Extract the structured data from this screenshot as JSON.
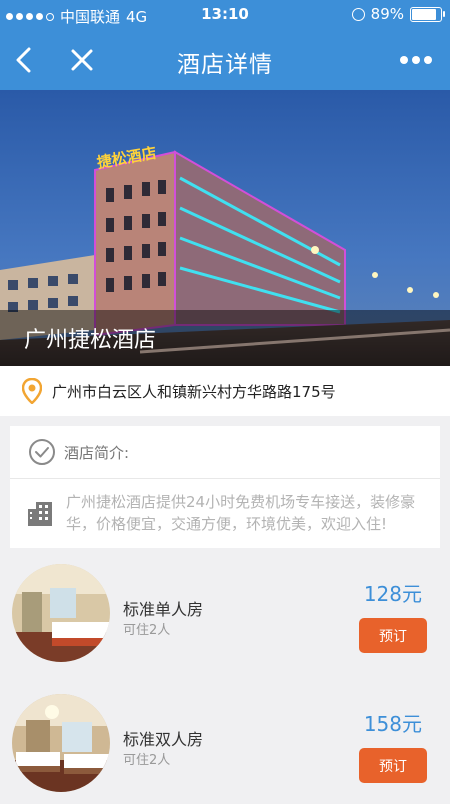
{
  "status_bar": {
    "carrier": "中国联通",
    "network": "4G",
    "time": "13:10",
    "battery": "89%"
  },
  "nav": {
    "title": "酒店详情",
    "back_icon": "chevron-left-icon",
    "close_icon": "close-icon",
    "more_icon": "more-dots-icon"
  },
  "hotel": {
    "name": "广州捷松酒店",
    "sign_text": "捷松酒店",
    "address": "广州市白云区人和镇新兴村方华路路175号"
  },
  "intro": {
    "label": "酒店简介:",
    "description": "广州捷松酒店提供24小时免费机场专车接送，装修豪华，价格便宜，交通方便，环境优美，欢迎入住!"
  },
  "rooms": [
    {
      "name": "标准单人房",
      "capacity": "可住2人",
      "price": "128元",
      "book_label": "预订"
    },
    {
      "name": "标准双人房",
      "capacity": "可住2人",
      "price": "158元",
      "book_label": "预订"
    }
  ],
  "colors": {
    "primary": "#3d8fd8",
    "book_button": "#e8622b",
    "location_pin": "#f2a532"
  }
}
